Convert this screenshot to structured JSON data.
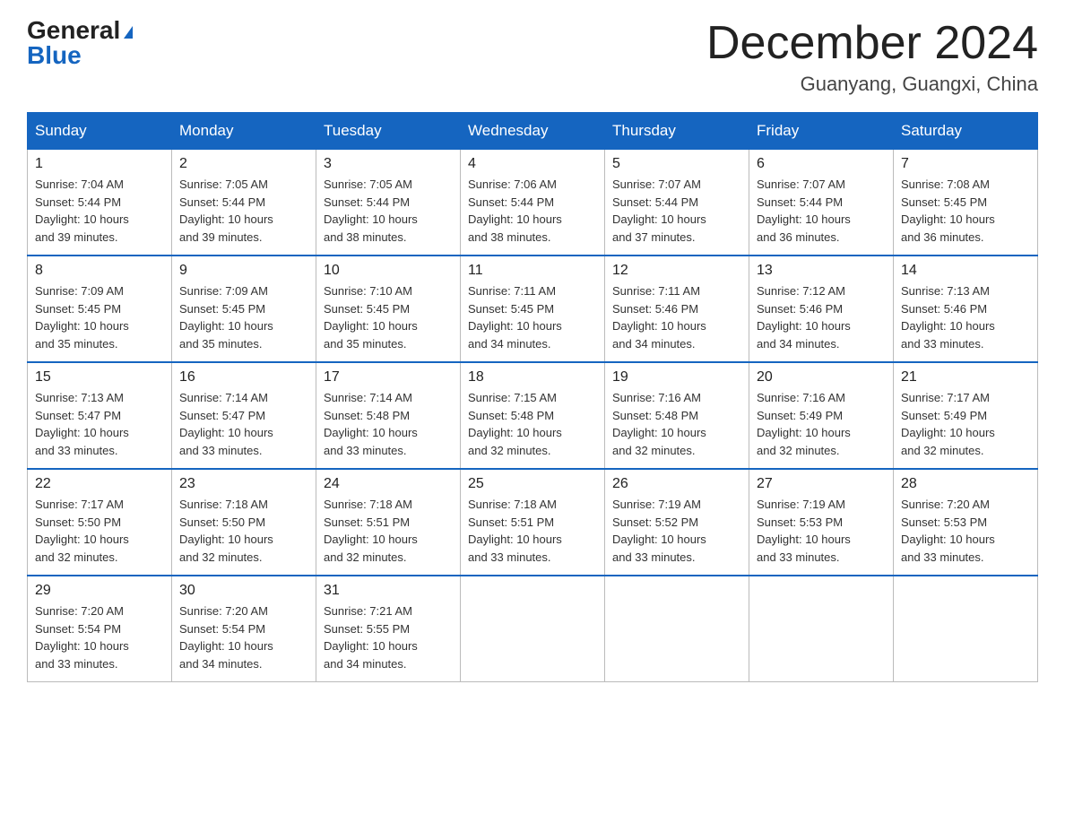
{
  "logo": {
    "general": "General",
    "blue": "Blue"
  },
  "header": {
    "month": "December 2024",
    "location": "Guanyang, Guangxi, China"
  },
  "weekdays": [
    "Sunday",
    "Monday",
    "Tuesday",
    "Wednesday",
    "Thursday",
    "Friday",
    "Saturday"
  ],
  "weeks": [
    [
      {
        "day": "1",
        "sunrise": "7:04 AM",
        "sunset": "5:44 PM",
        "daylight": "10 hours and 39 minutes."
      },
      {
        "day": "2",
        "sunrise": "7:05 AM",
        "sunset": "5:44 PM",
        "daylight": "10 hours and 39 minutes."
      },
      {
        "day": "3",
        "sunrise": "7:05 AM",
        "sunset": "5:44 PM",
        "daylight": "10 hours and 38 minutes."
      },
      {
        "day": "4",
        "sunrise": "7:06 AM",
        "sunset": "5:44 PM",
        "daylight": "10 hours and 38 minutes."
      },
      {
        "day": "5",
        "sunrise": "7:07 AM",
        "sunset": "5:44 PM",
        "daylight": "10 hours and 37 minutes."
      },
      {
        "day": "6",
        "sunrise": "7:07 AM",
        "sunset": "5:44 PM",
        "daylight": "10 hours and 36 minutes."
      },
      {
        "day": "7",
        "sunrise": "7:08 AM",
        "sunset": "5:45 PM",
        "daylight": "10 hours and 36 minutes."
      }
    ],
    [
      {
        "day": "8",
        "sunrise": "7:09 AM",
        "sunset": "5:45 PM",
        "daylight": "10 hours and 35 minutes."
      },
      {
        "day": "9",
        "sunrise": "7:09 AM",
        "sunset": "5:45 PM",
        "daylight": "10 hours and 35 minutes."
      },
      {
        "day": "10",
        "sunrise": "7:10 AM",
        "sunset": "5:45 PM",
        "daylight": "10 hours and 35 minutes."
      },
      {
        "day": "11",
        "sunrise": "7:11 AM",
        "sunset": "5:45 PM",
        "daylight": "10 hours and 34 minutes."
      },
      {
        "day": "12",
        "sunrise": "7:11 AM",
        "sunset": "5:46 PM",
        "daylight": "10 hours and 34 minutes."
      },
      {
        "day": "13",
        "sunrise": "7:12 AM",
        "sunset": "5:46 PM",
        "daylight": "10 hours and 34 minutes."
      },
      {
        "day": "14",
        "sunrise": "7:13 AM",
        "sunset": "5:46 PM",
        "daylight": "10 hours and 33 minutes."
      }
    ],
    [
      {
        "day": "15",
        "sunrise": "7:13 AM",
        "sunset": "5:47 PM",
        "daylight": "10 hours and 33 minutes."
      },
      {
        "day": "16",
        "sunrise": "7:14 AM",
        "sunset": "5:47 PM",
        "daylight": "10 hours and 33 minutes."
      },
      {
        "day": "17",
        "sunrise": "7:14 AM",
        "sunset": "5:48 PM",
        "daylight": "10 hours and 33 minutes."
      },
      {
        "day": "18",
        "sunrise": "7:15 AM",
        "sunset": "5:48 PM",
        "daylight": "10 hours and 32 minutes."
      },
      {
        "day": "19",
        "sunrise": "7:16 AM",
        "sunset": "5:48 PM",
        "daylight": "10 hours and 32 minutes."
      },
      {
        "day": "20",
        "sunrise": "7:16 AM",
        "sunset": "5:49 PM",
        "daylight": "10 hours and 32 minutes."
      },
      {
        "day": "21",
        "sunrise": "7:17 AM",
        "sunset": "5:49 PM",
        "daylight": "10 hours and 32 minutes."
      }
    ],
    [
      {
        "day": "22",
        "sunrise": "7:17 AM",
        "sunset": "5:50 PM",
        "daylight": "10 hours and 32 minutes."
      },
      {
        "day": "23",
        "sunrise": "7:18 AM",
        "sunset": "5:50 PM",
        "daylight": "10 hours and 32 minutes."
      },
      {
        "day": "24",
        "sunrise": "7:18 AM",
        "sunset": "5:51 PM",
        "daylight": "10 hours and 32 minutes."
      },
      {
        "day": "25",
        "sunrise": "7:18 AM",
        "sunset": "5:51 PM",
        "daylight": "10 hours and 33 minutes."
      },
      {
        "day": "26",
        "sunrise": "7:19 AM",
        "sunset": "5:52 PM",
        "daylight": "10 hours and 33 minutes."
      },
      {
        "day": "27",
        "sunrise": "7:19 AM",
        "sunset": "5:53 PM",
        "daylight": "10 hours and 33 minutes."
      },
      {
        "day": "28",
        "sunrise": "7:20 AM",
        "sunset": "5:53 PM",
        "daylight": "10 hours and 33 minutes."
      }
    ],
    [
      {
        "day": "29",
        "sunrise": "7:20 AM",
        "sunset": "5:54 PM",
        "daylight": "10 hours and 33 minutes."
      },
      {
        "day": "30",
        "sunrise": "7:20 AM",
        "sunset": "5:54 PM",
        "daylight": "10 hours and 34 minutes."
      },
      {
        "day": "31",
        "sunrise": "7:21 AM",
        "sunset": "5:55 PM",
        "daylight": "10 hours and 34 minutes."
      },
      null,
      null,
      null,
      null
    ]
  ],
  "labels": {
    "sunrise": "Sunrise:",
    "sunset": "Sunset:",
    "daylight": "Daylight:"
  }
}
